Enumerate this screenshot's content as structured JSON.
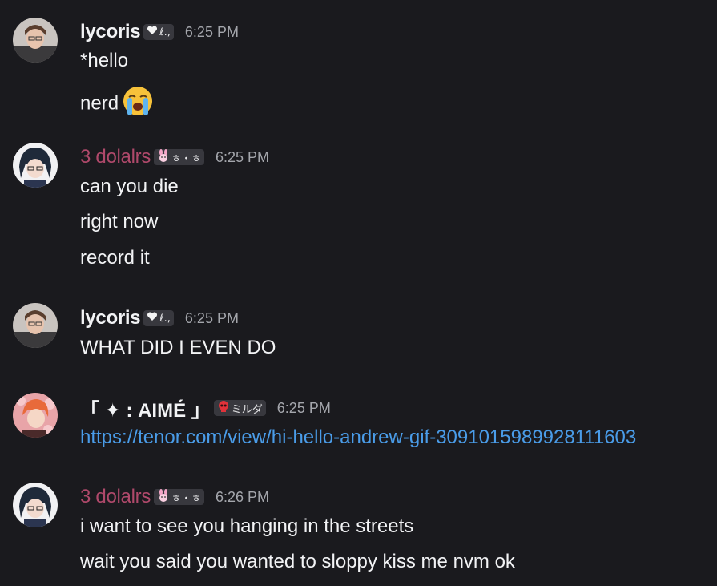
{
  "messages": [
    {
      "username": "lycoris",
      "tag": "ℓ.,",
      "tag_icon": "heart-icon",
      "timestamp": "6:25 PM",
      "lines": [
        "*hello",
        "nerd"
      ],
      "emoji": "loudly-crying-face-icon"
    },
    {
      "username": "3 dolalrs",
      "name_color": "#b0496b",
      "tag": "ㅎ・ㅎ",
      "tag_icon": "bunny-icon",
      "timestamp": "6:25 PM",
      "lines": [
        "can you die",
        "right now",
        "record it"
      ]
    },
    {
      "username": "lycoris",
      "tag": "ℓ.,",
      "tag_icon": "heart-icon",
      "timestamp": "6:25 PM",
      "lines": [
        "WHAT DID I EVEN DO"
      ]
    },
    {
      "username": "「 ✦ : AIMÉ 」",
      "tag": "ミルダ",
      "tag_icon": "skull-icon",
      "timestamp": "6:25 PM",
      "link": "https://tenor.com/view/hi-hello-andrew-gif-3091015989928111603"
    },
    {
      "username": "3 dolalrs",
      "name_color": "#b0496b",
      "tag": "ㅎ・ㅎ",
      "tag_icon": "bunny-icon",
      "timestamp": "6:26 PM",
      "lines": [
        "i want to see you hanging in the streets",
        "wait you said you wanted to sloppy kiss me nvm ok"
      ]
    }
  ],
  "colors": {
    "background": "#1a1a1e",
    "text": "#f2f3f5",
    "timestamp": "#a4a6ac",
    "link": "#4a9ce8",
    "pink_name": "#b0496b"
  }
}
